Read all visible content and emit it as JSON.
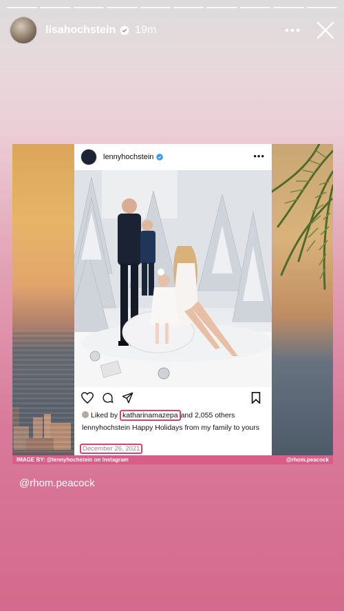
{
  "story": {
    "progress_segments": 10,
    "username": "lisahochstein",
    "time": "19m",
    "mention": "@rhom.peacock"
  },
  "post": {
    "username": "lennyhochstein",
    "more": "•••",
    "liked_prefix": "Liked by",
    "liked_user": "katharinamazepa",
    "liked_suffix": "and 2,055 others",
    "caption_user": "lennyhochstein",
    "caption_text": "Happy Holidays from my family to yours",
    "date": "December 26, 2021"
  },
  "credit": {
    "left": "IMAGE BY: @lennyhochstein on Instagram",
    "right": "@rhom.peacock"
  },
  "colors": {
    "highlight": "#d9426e",
    "credit_bar": "#d95d86",
    "verified": "#3897f0"
  }
}
